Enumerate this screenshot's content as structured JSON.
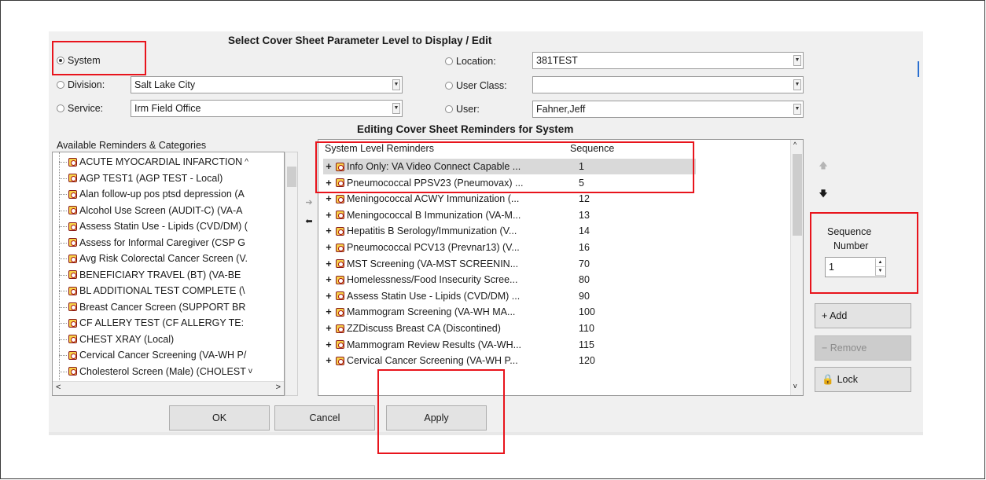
{
  "param_level": {
    "title": "Select Cover Sheet Parameter Level to Display / Edit",
    "system_label": "System",
    "division_label": "Division:",
    "division_value": "Salt Lake City",
    "service_label": "Service:",
    "service_value": "Irm Field Office",
    "location_label": "Location:",
    "location_value": "381TEST",
    "user_class_label": "User Class:",
    "user_class_value": "",
    "user_label": "User:",
    "user_value": "Fahner,Jeff",
    "selected": "System"
  },
  "editing_title": "Editing Cover Sheet Reminders for System",
  "available": {
    "label": "Available Reminders & Categories",
    "items": [
      "ACUTE MYOCARDIAL INFARCTION",
      "AGP TEST1 (AGP TEST - Local)",
      "Alan follow-up pos ptsd depression (A",
      "Alcohol Use Screen (AUDIT-C) (VA-A",
      "Assess Statin Use - Lipids (CVD/DM) (",
      "Assess for Informal Caregiver (CSP G",
      "Avg Risk Colorectal Cancer Screen (V.",
      "BENEFICIARY TRAVEL (BT) (VA-BE",
      "BL ADDITIONAL TEST COMPLETE (\\",
      "Breast Cancer Screen (SUPPORT BR",
      "CF ALLERY TEST (CF ALLERGY TE:",
      "CHEST XRAY (Local)",
      "Cervical Cancer Screening (VA-WH P/",
      "Cholesterol Screen (Male) (CHOLEST"
    ]
  },
  "system_list": {
    "header_name": "System Level Reminders",
    "header_seq": "Sequence",
    "rows": [
      {
        "name": "Info Only: VA Video Connect Capable ...",
        "seq": "1"
      },
      {
        "name": "Pneumococcal PPSV23 (Pneumovax) ...",
        "seq": "5"
      },
      {
        "name": "Meningococcal ACWY Immunization (...",
        "seq": "12"
      },
      {
        "name": "Meningococcal B Immunization (VA-M...",
        "seq": "13"
      },
      {
        "name": "Hepatitis B Serology/Immunization (V...",
        "seq": "14"
      },
      {
        "name": "Pneumococcal PCV13 (Prevnar13) (V...",
        "seq": "16"
      },
      {
        "name": "MST Screening (VA-MST SCREENIN...",
        "seq": "70"
      },
      {
        "name": "Homelessness/Food Insecurity Scree...",
        "seq": "80"
      },
      {
        "name": "Assess Statin Use - Lipids (CVD/DM) ...",
        "seq": "90"
      },
      {
        "name": "Mammogram Screening (VA-WH MA...",
        "seq": "100"
      },
      {
        "name": "ZZDiscuss Breast CA (Discontined)",
        "seq": "110"
      },
      {
        "name": "Mammogram Review Results (VA-WH...",
        "seq": "115"
      },
      {
        "name": "Cervical Cancer Screening (VA-WH P...",
        "seq": "120"
      }
    ]
  },
  "sequence": {
    "label_line1": "Sequence",
    "label_line2": "Number",
    "value": "1"
  },
  "buttons": {
    "add": "+ Add",
    "remove": "− Remove",
    "lock": "Lock",
    "ok": "OK",
    "cancel": "Cancel",
    "apply": "Apply"
  },
  "icons": {
    "reminder": "reminder-clock-icon",
    "move_right": "arrow-right-icon",
    "move_left": "arrow-left-icon",
    "up": "arrow-up-icon",
    "down": "arrow-down-icon",
    "lock": "lock-icon"
  },
  "colors": {
    "highlight_box": "#e8141c",
    "selected_row": "#d9d9d9"
  }
}
